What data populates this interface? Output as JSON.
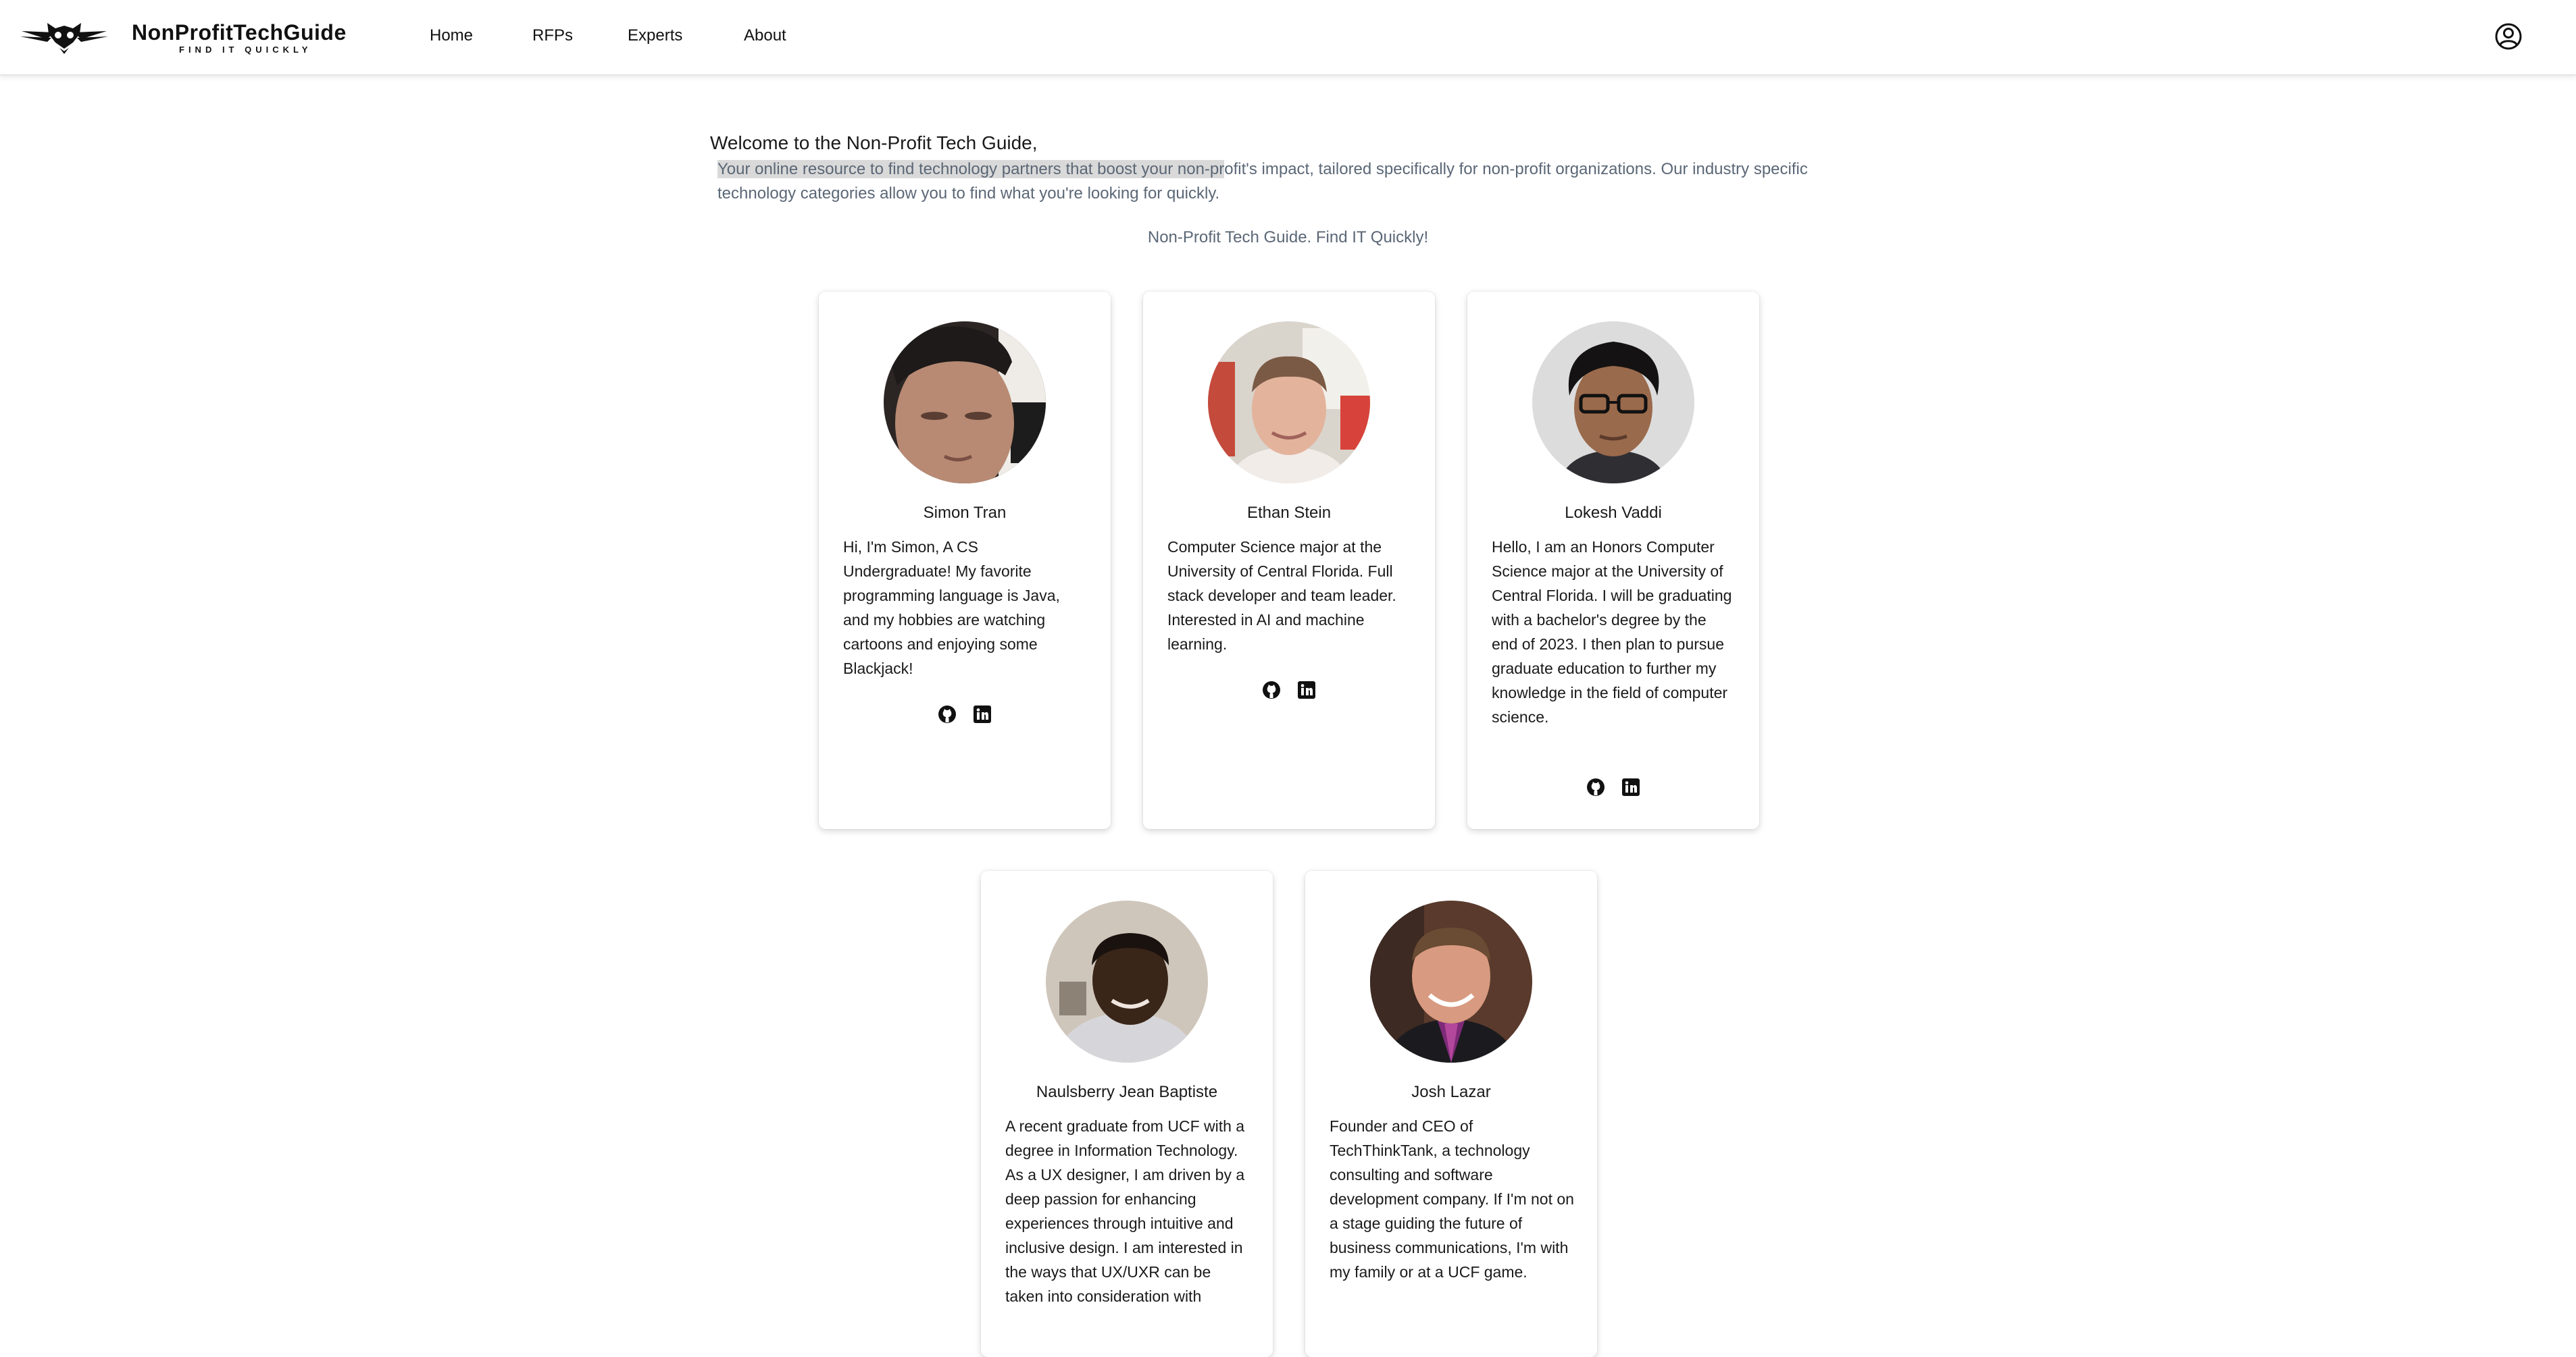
{
  "brand": {
    "name": "NonProfitTechGuide",
    "tagline": "FIND IT QUICKLY"
  },
  "nav": {
    "items": [
      {
        "label": "Home"
      },
      {
        "label": "RFPs"
      },
      {
        "label": "Experts"
      },
      {
        "label": "About"
      }
    ],
    "account_icon": "user-circle-icon"
  },
  "intro": {
    "welcome": "Welcome to the Non-Profit Tech Guide,",
    "highlighted": "Your online resource to find technology partners that boost your non-pr",
    "rest": "ofit's impact, tailored specifically for non-profit organizations. Our industry specific technology categories allow you to find what you're looking for quickly.",
    "tagline": "Non-Profit Tech Guide. Find IT Quickly!"
  },
  "team": [
    {
      "name": "Simon Tran",
      "bio": "Hi, I'm Simon, A CS Undergraduate! My favorite programming language is Java, and my hobbies are watching cartoons and enjoying some Blackjack!",
      "links": [
        "github-icon",
        "linkedin-icon"
      ]
    },
    {
      "name": "Ethan Stein",
      "bio": "Computer Science major at the University of Central Florida. Full stack developer and team leader. Interested in AI and machine learning.",
      "links": [
        "github-icon",
        "linkedin-icon"
      ]
    },
    {
      "name": "Lokesh Vaddi",
      "bio": "Hello, I am an Honors Computer Science major at the University of Central Florida. I will be graduating with a bachelor's degree by the end of 2023. I then plan to pursue graduate education to further my knowledge in the field of computer science.",
      "links": [
        "github-icon",
        "linkedin-icon"
      ]
    },
    {
      "name": "Naulsberry Jean Baptiste",
      "bio": "A recent graduate from UCF with a degree in Information Technology. As a UX designer, I am driven by a deep passion for enhancing experiences through intuitive and inclusive design. I am interested in the ways that UX/UXR can be taken into consideration with",
      "links": []
    },
    {
      "name": "Josh Lazar",
      "bio": "Founder and CEO of TechThinkTank, a technology consulting and software development company. If I'm not on a stage guiding the future of business communications, I'm with my family or at a UCF game.",
      "links": []
    }
  ]
}
